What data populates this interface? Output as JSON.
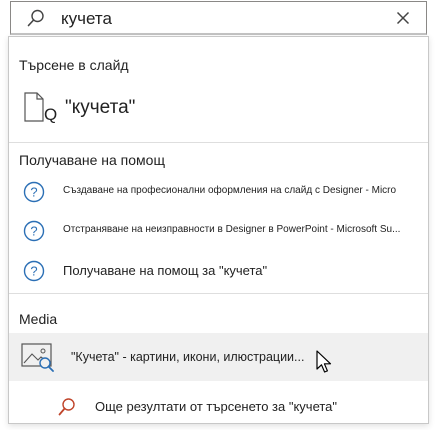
{
  "search": {
    "query": "кучета"
  },
  "sections": {
    "slide_search_title": "Търсене в слайд",
    "help_title": "Получаване на помощ",
    "media_title": "Media"
  },
  "slide_result": {
    "label": "\"кучета\""
  },
  "help_items": [
    {
      "label": "Създаване на професионални оформления на слайд с Designer - Micro"
    },
    {
      "label": "Отстраняване на неизправности в Designer в PowerPoint - Microsoft Su..."
    },
    {
      "label": "Получаване на помощ за \"кучета\""
    }
  ],
  "media_item": {
    "label": "\"Кучета\" - картини, икони, илюстрации..."
  },
  "more_results": {
    "label": "Още резултати от търсенето за \"кучета\""
  },
  "colors": {
    "accent_blue": "#2b6fb5",
    "search_orange": "#c0452b"
  }
}
